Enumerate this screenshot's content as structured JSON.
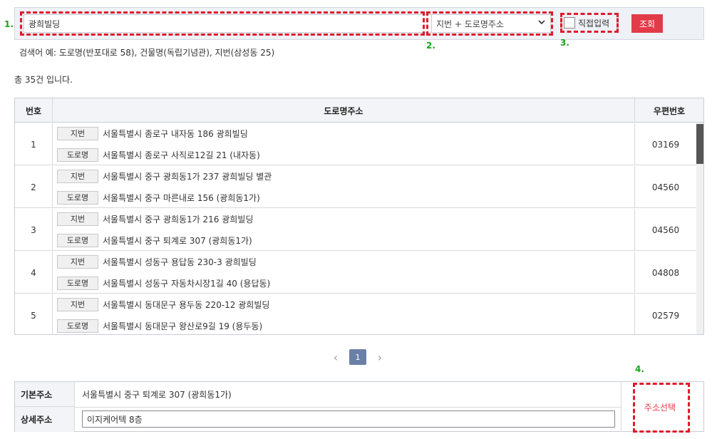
{
  "markers": {
    "m1": "1.",
    "m2": "2.",
    "m3": "3.",
    "m4": "4."
  },
  "search": {
    "value": "광희빌딩",
    "type_selected": "지번 + 도로명주소",
    "direct_label": "직접입력",
    "button_label": "조회"
  },
  "hint": "검색어 예: 도로명(반포대로 58), 건물명(독립기념관), 지번(삼성동 25)",
  "count_text": "총 35건 입니다.",
  "table": {
    "headers": {
      "no": "번호",
      "road": "도로명주소",
      "zip": "우편번호"
    },
    "tag_jibun": "지번",
    "tag_road": "도로명",
    "rows": [
      {
        "no": "1",
        "jibun": "서울특별시 종로구 내자동 186 광희빌딩",
        "road": "서울특별시 종로구 사직로12길 21 (내자동)",
        "zip": "03169"
      },
      {
        "no": "2",
        "jibun": "서울특별시 중구 광희동1가 237 광희빌딩 별관",
        "road": "서울특별시 중구 마른내로 156 (광희동1가)",
        "zip": "04560"
      },
      {
        "no": "3",
        "jibun": "서울특별시 중구 광희동1가 216 광희빌딩",
        "road": "서울특별시 중구 퇴계로 307 (광희동1가)",
        "zip": "04560"
      },
      {
        "no": "4",
        "jibun": "서울특별시 성동구 용답동 230-3 광희빌딩",
        "road": "서울특별시 성동구 자동차시장1길 40 (용답동)",
        "zip": "04808"
      },
      {
        "no": "5",
        "jibun": "서울특별시 동대문구 용두동 220-12 광희빌딩",
        "road": "서울특별시 동대문구 왕산로9길 19 (용두동)",
        "zip": "02579"
      }
    ]
  },
  "pager": {
    "prev": "‹",
    "current": "1",
    "next": "›"
  },
  "result": {
    "basic_label": "기본주소",
    "basic_value": "서울특별시 중구 퇴계로 307 (광희동1가)",
    "detail_label": "상세주소",
    "detail_value": "이지케어텍 8층",
    "select_button": "주소선택"
  },
  "colors": {
    "accent": "#e23b48",
    "marker": "#19a319",
    "highlight_dash": "#e01a2b",
    "page_active": "#6a7fa6"
  },
  "icons": {
    "dropdown": "chevron-down-icon",
    "prev": "chevron-left-icon",
    "next": "chevron-right-icon"
  }
}
